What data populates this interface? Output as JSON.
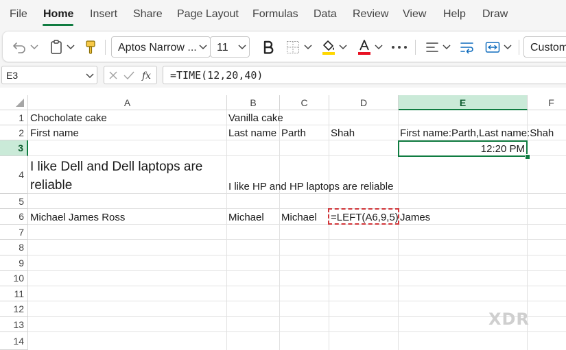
{
  "ribbon": {
    "tabs": [
      "File",
      "Home",
      "Insert",
      "Share",
      "Page Layout",
      "Formulas",
      "Data",
      "Review",
      "View",
      "Help",
      "Draw"
    ],
    "active_tab": "Home"
  },
  "toolbar": {
    "font_name": "Aptos Narrow ...",
    "font_size": "11",
    "number_format": "Custom",
    "accent_color": "#107c41",
    "font_color_bar": "#e81123",
    "fill_color_bar": "#ffd700"
  },
  "formula_bar": {
    "name_box": "E3",
    "formula": "=TIME(12,20,40)"
  },
  "grid": {
    "columns": [
      "A",
      "B",
      "C",
      "D",
      "E",
      "F"
    ],
    "selected_column": "E",
    "rows": [
      "1",
      "2",
      "3",
      "4",
      "5",
      "6",
      "7",
      "8",
      "9",
      "10",
      "11",
      "12",
      "13",
      "14"
    ],
    "selected_row": "3",
    "cells": {
      "A1": "Chocholate cake",
      "B1": "Vanilla cake",
      "A2": "First name",
      "B2": "Last name",
      "C2": "Parth",
      "D2": "Shah",
      "E2": "First name:Parth,Last name:Shah",
      "E3": "12:20 PM",
      "A4": "I like Dell and Dell laptops are reliable",
      "B4": "I like HP and HP laptops are reliable",
      "A6": "Michael James Ross",
      "B6": "Michael",
      "C6": "Michael",
      "D6": "=LEFT(A6,9,5)",
      "E6": "James"
    }
  },
  "watermark": "XDR"
}
